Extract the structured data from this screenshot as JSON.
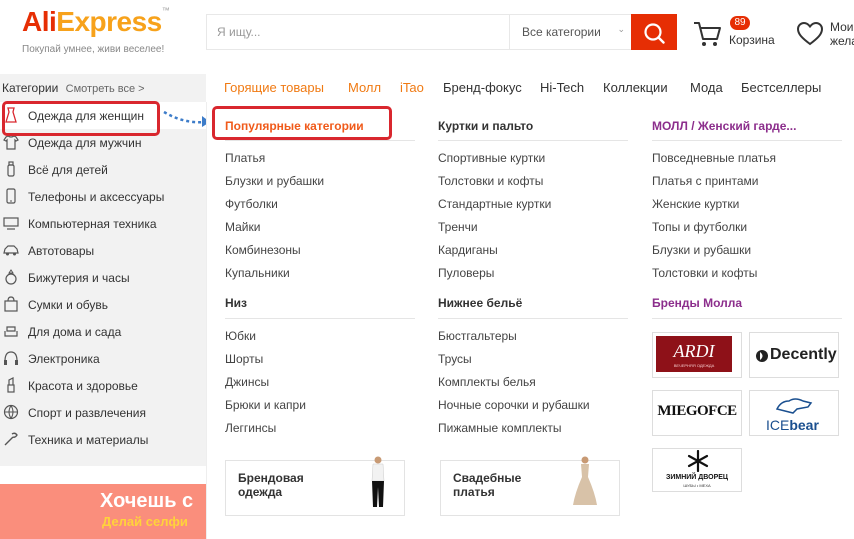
{
  "header": {
    "logo_ali": "Ali",
    "logo_express": "Express",
    "tagline": "Покупай умнее, живи веселее!",
    "search_placeholder": "Я ищу...",
    "search_category": "Все категории",
    "cart_count": "89",
    "cart_label": "Корзина",
    "wishlist_label_1": "Мои",
    "wishlist_label_2": "жела",
    "brand_color": "#e62e04"
  },
  "sidebar": {
    "title": "Категории",
    "see_all": "Смотреть все >",
    "items": [
      {
        "label": "Одежда для женщин",
        "icon": "dress-icon"
      },
      {
        "label": "Одежда для мужчин",
        "icon": "shirt-icon"
      },
      {
        "label": "Всё для детей",
        "icon": "bottle-icon"
      },
      {
        "label": "Телефоны и аксессуары",
        "icon": "phone-icon"
      },
      {
        "label": "Компьютерная техника",
        "icon": "computer-icon"
      },
      {
        "label": "Автотовары",
        "icon": "car-icon"
      },
      {
        "label": "Бижутерия и часы",
        "icon": "ring-icon"
      },
      {
        "label": "Сумки и обувь",
        "icon": "bag-icon"
      },
      {
        "label": "Для дома и сада",
        "icon": "sofa-icon"
      },
      {
        "label": "Электроника",
        "icon": "headphones-icon"
      },
      {
        "label": "Красота и здоровье",
        "icon": "lipstick-icon"
      },
      {
        "label": "Спорт и развлечения",
        "icon": "ball-icon"
      },
      {
        "label": "Техника и материалы",
        "icon": "tools-icon"
      }
    ]
  },
  "promo": {
    "title": "Хочешь с",
    "subtitle": "Делай селфи"
  },
  "topnav": [
    "Горящие товары",
    "Молл",
    "iTao",
    "Бренд-фокус",
    "Hi-Tech",
    "Коллекции",
    "Мода",
    "Бестселлеры"
  ],
  "menu": {
    "col1": {
      "heading1": "Популярные категории",
      "items1": [
        "Платья",
        "Блузки и рубашки",
        "Футболки",
        "Майки",
        "Комбинезоны",
        "Купальники"
      ],
      "heading2": "Низ",
      "items2": [
        "Юбки",
        "Шорты",
        "Джинсы",
        "Брюки и капри",
        "Леггинсы"
      ]
    },
    "col2": {
      "heading1": "Куртки и пальто",
      "items1": [
        "Спортивные куртки",
        "Толстовки и кофты",
        "Стандартные куртки",
        "Тренчи",
        "Кардиганы",
        "Пуловеры"
      ],
      "heading2": "Нижнее бельё",
      "items2": [
        "Бюстгальтеры",
        "Трусы",
        "Комплекты белья",
        "Ночные сорочки и рубашки",
        "Пижамные комплекты"
      ]
    },
    "col3": {
      "heading1": "МОЛЛ / Женский гарде...",
      "items1": [
        "Повседневные платья",
        "Платья с принтами",
        "Женские куртки",
        "Топы и футболки",
        "Блузки и рубашки",
        "Толстовки и кофты"
      ],
      "heading2": "Бренды Молла"
    },
    "cards": [
      {
        "line1": "Брендовая",
        "line2": "одежда"
      },
      {
        "line1": "Свадебные",
        "line2": "платья"
      }
    ],
    "brands": {
      "ardi": "ARDI",
      "ardi_sub": "ВЕЧЕРНЯЯ ОДЕЖДА",
      "decently": "Decently",
      "miegofce": "MIEGOFCE",
      "icebear_ice": "ICE",
      "icebear_bear": "bear",
      "zimniy": "ЗИМНИЙ ДВОРЕЦ",
      "zimniy_sub": "ШУБЫ • МЕХА"
    }
  }
}
